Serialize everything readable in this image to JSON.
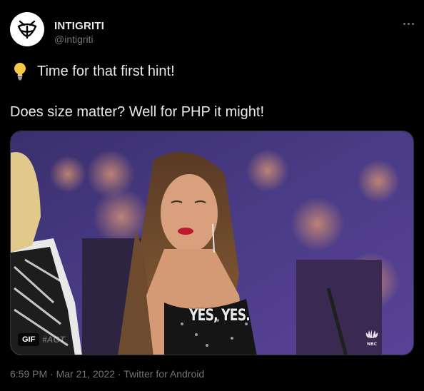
{
  "tweet": {
    "display_name": "INTIGRITI",
    "handle": "@intigriti",
    "lines": [
      "Time for that first hint!",
      "Does size matter? Well for PHP it might!"
    ],
    "media": {
      "caption": "YES, YES.",
      "badge": "GIF",
      "watermark": "#AGT",
      "network_label": "NBC"
    },
    "meta": {
      "time": "6:59 PM",
      "separator": "·",
      "date": "Mar 21, 2022",
      "source": "Twitter for Android"
    }
  },
  "icons": {
    "avatar": "intigriti-bee-logo",
    "bulb": "light-bulb-emoji",
    "more": "more-dots-icon",
    "network": "nbc-peacock-logo"
  },
  "colors": {
    "background": "#000000",
    "text": "#e7e9ea",
    "secondary_text": "#71767b",
    "border": "#2f3336"
  }
}
